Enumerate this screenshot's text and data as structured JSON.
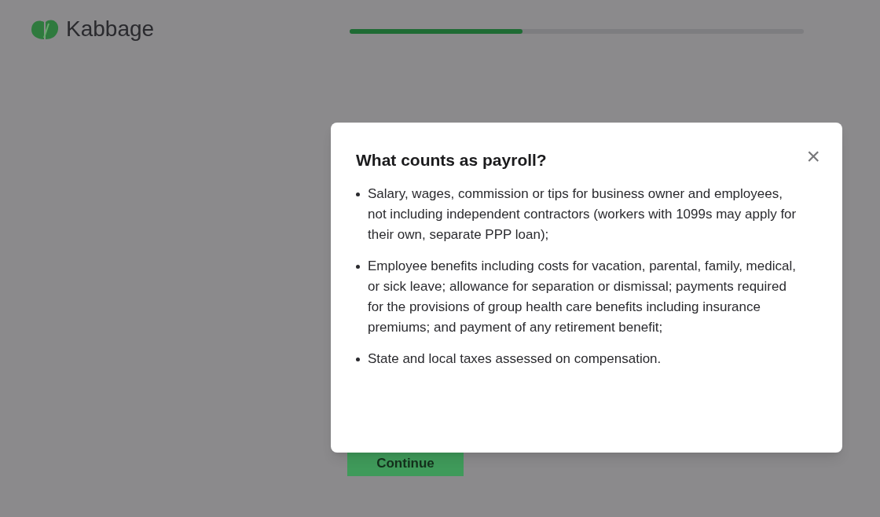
{
  "header": {
    "logo_text": "Kabbage"
  },
  "progress": {
    "level": 0.38
  },
  "continue_button": {
    "label": "Continue"
  },
  "dialog": {
    "title": "What counts as payroll?",
    "close": "×",
    "items": [
      "Salary, wages, commission or tips for business owner and employees, not including independent contractors (workers with 1099s may apply for their own, separate PPP loan);",
      "Employee benefits including costs for vacation, parental, family, medical, or sick leave; allowance for separation or dismissal; payments required for the provisions of group health care benefits including insurance premiums; and payment of any retirement benefit;",
      "State and local taxes assessed on compensation."
    ]
  }
}
